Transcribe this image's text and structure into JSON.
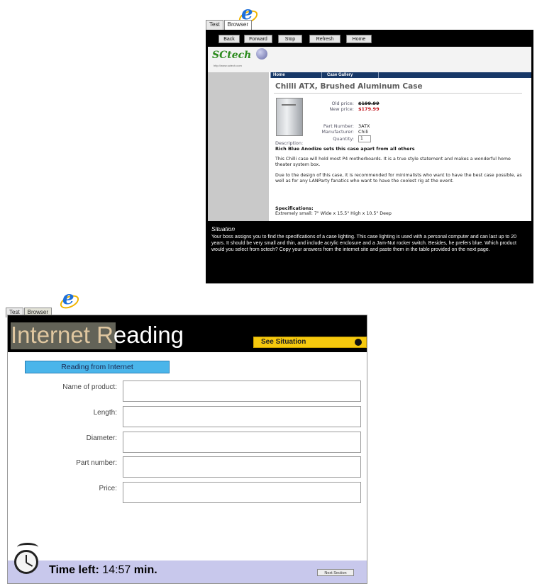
{
  "panel1": {
    "tabs": [
      "Test",
      "Browser"
    ],
    "nav_buttons": [
      "Back",
      "Forward",
      "Stop",
      "Refresh",
      "Home"
    ],
    "site": {
      "logo": "SCtech",
      "logo_url": "http://www.sctech.com",
      "nav_links": [
        "Home",
        "Case Gallery"
      ],
      "product_title": "Chilli ATX, Brushed Aluminum Case",
      "old_price_label": "Old price:",
      "old_price": "$199.99",
      "new_price_label": "New price:",
      "new_price": "$179.99",
      "part_number_label": "Part Number:",
      "part_number": "3ATX",
      "manufacturer_label": "Manufacturer:",
      "manufacturer": "Chili",
      "quantity_label": "Quantity:",
      "quantity": "1",
      "description_label": "Description:",
      "description_bold": "Rich Blue Anodize sets this case apart from all others",
      "paragraph1": "This Chilli case will hold most P4 motherboards. It is a true style statement and makes a wonderful home theater system box.",
      "paragraph2": "Due to the design of this case, it is recommended for minimalists who want to have the best case possible, as well as for any LANParty fanatics who want to have the coolest rig at the event.",
      "specs_label": "Specifications:",
      "specs_text": "Extremely small: 7\" Wide x 15.5\" High x 10.5\" Deep"
    },
    "situation_heading": "Situation",
    "situation_text": "Your boss assigns you to find the specifications of a case lighting. This case lighting is used with a personal computer and can last up to 20 years. It should be very small and thin, and include acrylic enclosure and a Jam-Nut rocker switch. Besides, he prefers blue.  Which product would you select from sctech?  Copy your answers from the internet site and paste them in the table provided on the next page."
  },
  "panel2": {
    "tabs": [
      "Test",
      "Browser"
    ],
    "title_part1": "Internet R",
    "title_part2": "eading",
    "see_situation": "See Situation",
    "section_label": "Reading from Internet",
    "fields": [
      {
        "label": "Name of product:",
        "value": ""
      },
      {
        "label": "Length:",
        "value": ""
      },
      {
        "label": "Diameter:",
        "value": ""
      },
      {
        "label": "Part number:",
        "value": ""
      },
      {
        "label": "Price:",
        "value": ""
      }
    ],
    "time_left_label": "Time left:",
    "time_value": "14:57",
    "time_unit": "min.",
    "next_button": "Next Section"
  },
  "colors": {
    "ie_blue": "#1e6fd9",
    "site_nav": "#173867",
    "new_price": "#c0161f",
    "see_situation": "#f6c90e",
    "section_label_bg": "#4ab5ea",
    "footer_bg": "#c8c8ec"
  }
}
